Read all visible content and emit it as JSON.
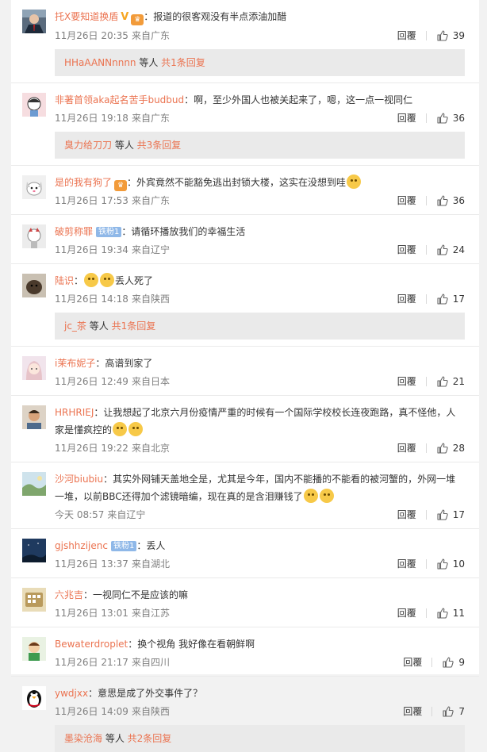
{
  "comments": [
    {
      "user": "托X要知道换盾",
      "badges": [
        "v",
        "vip"
      ],
      "text": "：报道的很客观没有半点添油加醋",
      "time": "11月26日 20:35",
      "source": "来自广东",
      "reply_label": "回覆",
      "likes": "39",
      "avatar": "suit-man",
      "replies": {
        "user": "HHaAANNnnnn",
        "mid": " 等人 ",
        "count": "共1条回复"
      }
    },
    {
      "user": "非著首领aka起名苦手budbud",
      "text": "：啊，至少外国人也被关起来了，嗯，这一点一视同仁",
      "time": "11月26日 19:18",
      "source": "来自广东",
      "reply_label": "回覆",
      "likes": "36",
      "avatar": "cartoon-person",
      "replies": {
        "user": "臭力给刀刀",
        "mid": " 等人 ",
        "count": "共3条回复"
      }
    },
    {
      "user": "是的我有狗了",
      "badges": [
        "vip"
      ],
      "text": "：外宾竟然不能豁免逃出封锁大楼，这实在没想到哇",
      "emojis": 1,
      "time": "11月26日 17:53",
      "source": "来自广东",
      "reply_label": "回覆",
      "likes": "36",
      "avatar": "dog"
    },
    {
      "user": "破剪称罪",
      "badges": [
        "lv"
      ],
      "lv_text": "铁粉1",
      "text": "：请循环播放我们的幸福生活",
      "time": "11月26日 19:34",
      "source": "来自辽宁",
      "reply_label": "回覆",
      "likes": "24",
      "avatar": "cartoon-white"
    },
    {
      "user": "陆识",
      "text": "：",
      "emojis_before": 2,
      "text_after": "丢人死了",
      "time": "11月26日 14:18",
      "source": "来自陕西",
      "reply_label": "回覆",
      "likes": "17",
      "avatar": "animal-dark",
      "replies": {
        "user": "jc_茶",
        "mid": " 等人 ",
        "count": "共1条回复"
      }
    },
    {
      "user": "i茉布妮子",
      "text": "：高谱到家了",
      "time": "11月26日 12:49",
      "source": "来自日本",
      "reply_label": "回覆",
      "likes": "21",
      "avatar": "anime-girl"
    },
    {
      "user": "HRHRIEJ",
      "text": "：让我想起了北京六月份疫情严重的时候有一个国际学校校长连夜跑路，真不怪他，人家是懂疯控的",
      "emojis": 2,
      "time": "11月26日 19:22",
      "source": "来自北京",
      "reply_label": "回覆",
      "likes": "28",
      "avatar": "man-portrait"
    },
    {
      "user": "沙河biubiu",
      "text": "：其实外网铺天盖地全是，尤其是今年，国内不能播的不能看的被河蟹的，外网一堆一堆，以前BBC还得加个滤镜暗编，现在真的是含泪赚钱了",
      "emojis": 2,
      "time": "今天 08:57",
      "source": "来自辽宁",
      "reply_label": "回覆",
      "likes": "17",
      "avatar": "landscape"
    },
    {
      "user": "gjshhzijenc",
      "badges": [
        "lv"
      ],
      "lv_text": "铁粉1",
      "text": "：丢人",
      "time": "11月26日 13:37",
      "source": "来自湖北",
      "reply_label": "回覆",
      "likes": "10",
      "avatar": "night-sky"
    },
    {
      "user": "六兆吉",
      "text": "：一视同仁不是应该的嘛",
      "time": "11月26日 13:01",
      "source": "来自江苏",
      "reply_label": "回覆",
      "likes": "11",
      "avatar": "game-box"
    },
    {
      "user": "Bewaterdroplet",
      "text": "：换个视角 我好像在看朝鲜啊",
      "time": "11月26日 21:17",
      "source": "来自四川",
      "reply_label": "回覆",
      "likes": "9",
      "avatar": "cartoon-kid"
    },
    {
      "user": "ywdjxx",
      "text": "：意思是成了外交事件了？",
      "time": "11月26日 14:09",
      "source": "来自陕西",
      "reply_label": "回覆",
      "likes": "7",
      "avatar": "penguin",
      "replies": {
        "user": "墨染沧海",
        "mid": " 等人 ",
        "count": "共2条回复"
      }
    }
  ]
}
